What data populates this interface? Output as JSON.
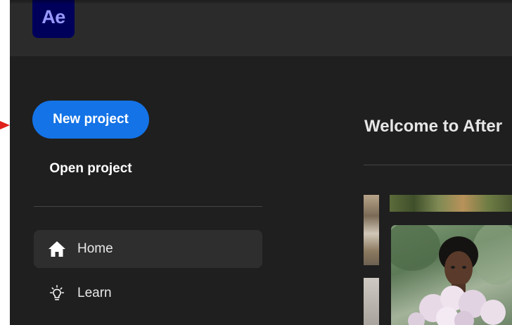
{
  "app": {
    "logo_text": "Ae"
  },
  "sidebar": {
    "new_project_label": "New project",
    "open_project_label": "Open project",
    "nav": [
      {
        "label": "Home",
        "icon": "home-icon",
        "active": true
      },
      {
        "label": "Learn",
        "icon": "lightbulb-icon",
        "active": false
      }
    ]
  },
  "main": {
    "welcome_title": "Welcome to After"
  },
  "colors": {
    "accent": "#1473e6",
    "logo_bg": "#00005b",
    "logo_fg": "#9999ff",
    "pointer": "#e0201a"
  }
}
